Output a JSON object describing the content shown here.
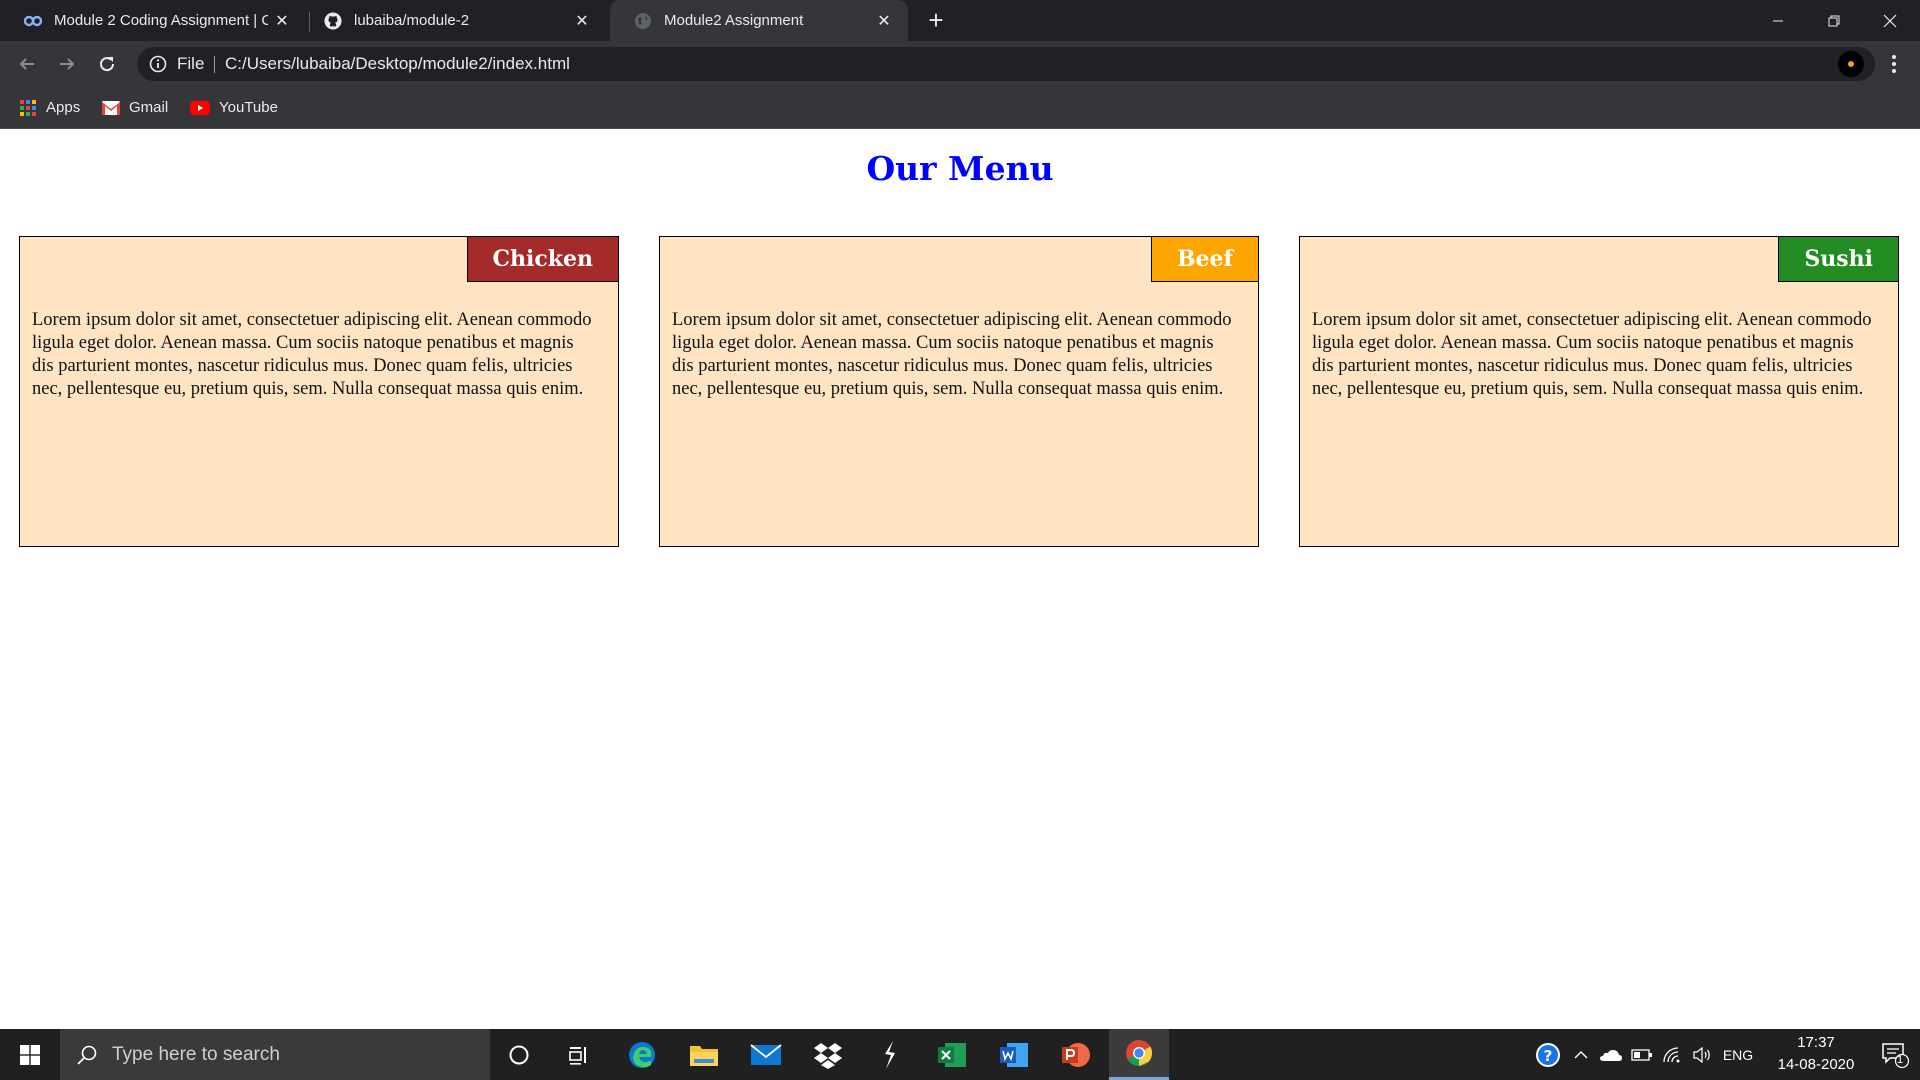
{
  "browser": {
    "tabs": [
      {
        "title": "Module 2 Coding Assignment | C",
        "icon": "coursera-icon",
        "active": false
      },
      {
        "title": "lubaiba/module-2",
        "icon": "github-icon",
        "active": false
      },
      {
        "title": "Module2 Assignment",
        "icon": "globe-icon",
        "active": true
      }
    ],
    "new_tab": "+",
    "address": {
      "scheme_label": "File",
      "url": "C:/Users/lubaiba/Desktop/module2/index.html"
    },
    "bookmarks": [
      {
        "label": "Apps",
        "icon": "apps-grid-icon"
      },
      {
        "label": "Gmail",
        "icon": "gmail-icon"
      },
      {
        "label": "YouTube",
        "icon": "youtube-icon"
      }
    ]
  },
  "page": {
    "title": "Our Menu",
    "cards": [
      {
        "label": "Chicken",
        "label_color": "#a52a2a",
        "text": "Lorem ipsum dolor sit amet, consectetuer adipiscing elit. Aenean commodo ligula eget dolor. Aenean massa. Cum sociis natoque penatibus et magnis dis parturient montes, nascetur ridiculus mus. Donec quam felis, ultricies nec, pellentesque eu, pretium quis, sem. Nulla consequat massa quis enim."
      },
      {
        "label": "Beef",
        "label_color": "#ffa500",
        "text": "Lorem ipsum dolor sit amet, consectetuer adipiscing elit. Aenean commodo ligula eget dolor. Aenean massa. Cum sociis natoque penatibus et magnis dis parturient montes, nascetur ridiculus mus. Donec quam felis, ultricies nec, pellentesque eu, pretium quis, sem. Nulla consequat massa quis enim."
      },
      {
        "label": "Sushi",
        "label_color": "#228b22",
        "text": "Lorem ipsum dolor sit amet, consectetuer adipiscing elit. Aenean commodo ligula eget dolor. Aenean massa. Cum sociis natoque penatibus et magnis dis parturient montes, nascetur ridiculus mus. Donec quam felis, ultricies nec, pellentesque eu, pretium quis, sem. Nulla consequat massa quis enim."
      }
    ],
    "card_background": "#ffe4c4",
    "title_color": "#0000ff"
  },
  "taskbar": {
    "search_placeholder": "Type here to search",
    "apps": [
      "cortana-icon",
      "task-view-icon",
      "edge-icon",
      "file-explorer-icon",
      "mail-icon",
      "dropbox-icon",
      "sublime-icon",
      "excel-icon",
      "word-icon",
      "powerpoint-icon",
      "chrome-icon"
    ],
    "language": "ENG",
    "time": "17:37",
    "date": "14-08-2020",
    "notification_count": "1"
  }
}
